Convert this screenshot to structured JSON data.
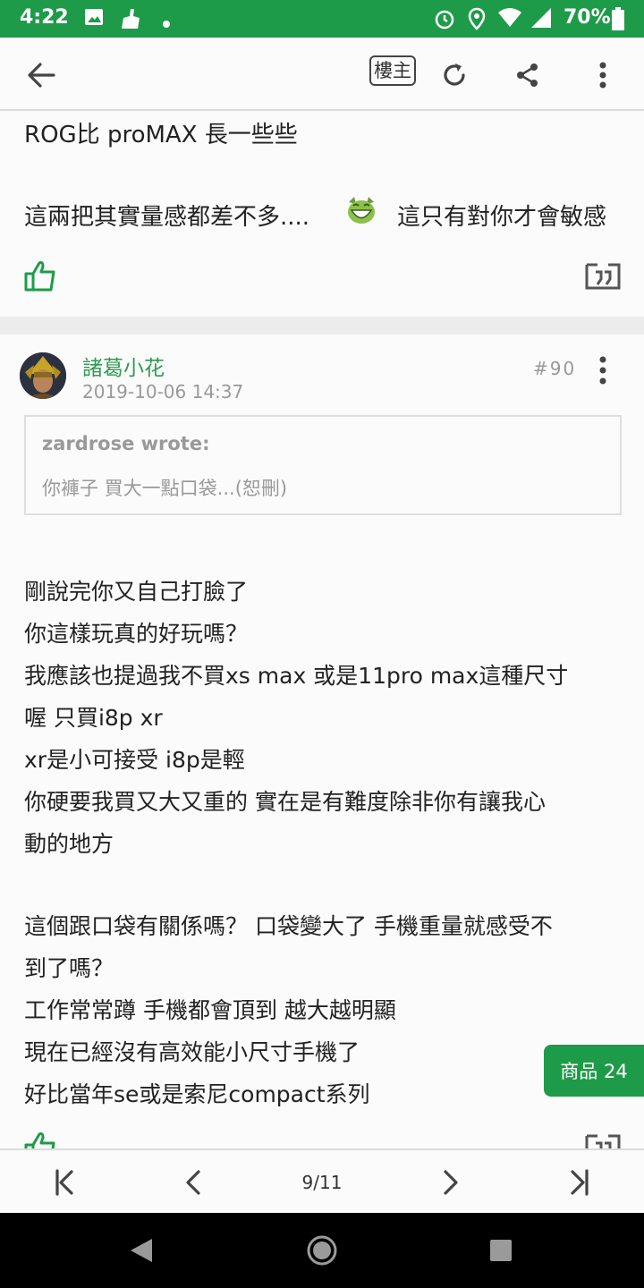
{
  "status_bar": {
    "time": "4:22",
    "battery": "70%",
    "icons": [
      "photo-icon",
      "cleaner-icon",
      "dot-icon",
      "alarm-icon",
      "location-icon",
      "wifi-icon",
      "signal-icon",
      "battery-icon"
    ]
  },
  "toolbar": {
    "author_only_label": "樓主",
    "icons": [
      "back-arrow-icon",
      "refresh-icon",
      "share-icon",
      "more-vertical-icon"
    ]
  },
  "previous_post": {
    "line1": "ROG比 proMAX 長一些些",
    "line2_left": "這兩把其實量感都差不多....",
    "line2_right": "這只有對你才會敏感",
    "emoji": "laughing-emoji"
  },
  "post": {
    "author": "諸葛小花",
    "date": "2019-10-06 14:37",
    "floor": "#90",
    "quote_author": "zardrose wrote:",
    "quote_text": "你褲子 買大一點口袋...(恕刪)",
    "lines": [
      "剛說完你又自己打臉了",
      "你這樣玩真的好玩嗎？",
      "我應該也提過我不買xs max 或是11pro max這種尺寸",
      "喔 只買i8p xr",
      "xr是小可接受 i8p是輕",
      "你硬要我買又大又重的 實在是有難度除非你有讓我心",
      "動的地方",
      "這個跟口袋有關係嗎？ 口袋變大了 手機重量就感受不",
      "到了嗎？",
      "工作常常蹲 手機都會頂到 越大越明顯",
      "現在已經沒有高效能小尺寸手機了",
      "好比當年se或是索尼compact系列"
    ]
  },
  "fab": {
    "label": "商品 24"
  },
  "pager": {
    "indicator": "9/11"
  },
  "colors": {
    "brand_green": "#1e9b48",
    "author_green": "#2e9b4f"
  }
}
